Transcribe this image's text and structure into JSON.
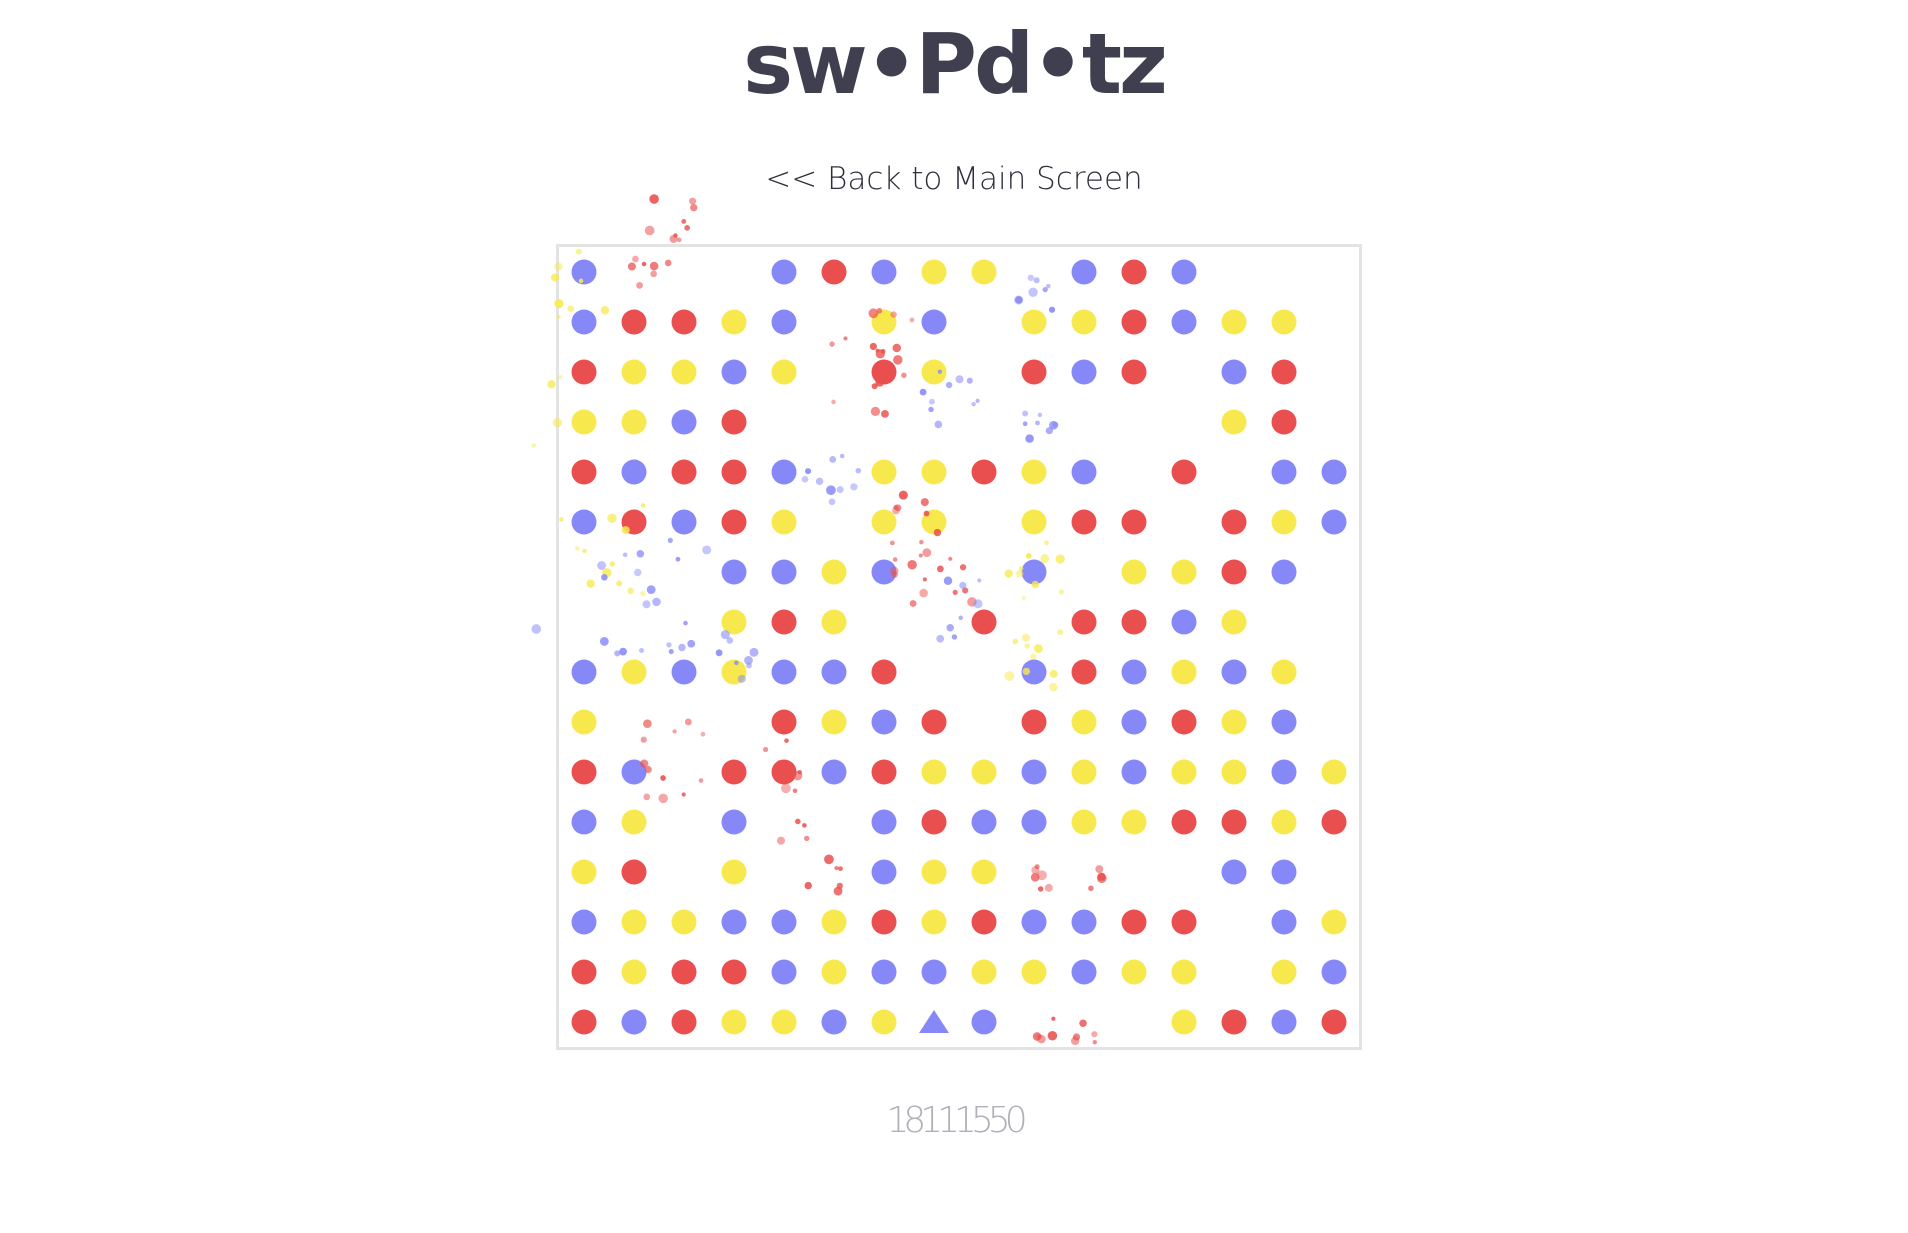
{
  "app": {
    "title": "sw•Pd•tz",
    "back_link": "<< Back to Main Screen",
    "score": "18111550"
  },
  "colors": {
    "R": "#ea4f4f",
    "B": "#8688f7",
    "Y": "#f7e94d",
    "title": "#3f3f50",
    "border": "#e3e3e3"
  },
  "board": {
    "rows": 16,
    "cols": 16,
    "legend": "R = red dot, B = blue dot, Y = yellow dot, . = empty cell, T = blue triangle cursor",
    "grid": [
      "B...BRBYY.BRB...",
      "BRRYB.YB.YYRBYY.",
      "RYYBY.RY.RBR.BR.",
      "YYBR.........YR.",
      "RBRRB.YYRYB.R.BB",
      "BRBRY.YY.YRR.RYB",
      "...BBYB..B.YYRB.",
      "...YRY..R.RRBY..",
      "BYBYBBR..BRBYBY.",
      "Y...RYBR.RYBRYB.",
      "RB.RRBRYYBYBYYBY",
      "BY.B..BRBBYYRRYR",
      "YR.Y..BYY....BB.",
      "BYYBBYRYRBBRR.BY",
      "RYRRBYBBYYBYY.YB",
      "RBRYYBYTB...YRBR"
    ]
  }
}
